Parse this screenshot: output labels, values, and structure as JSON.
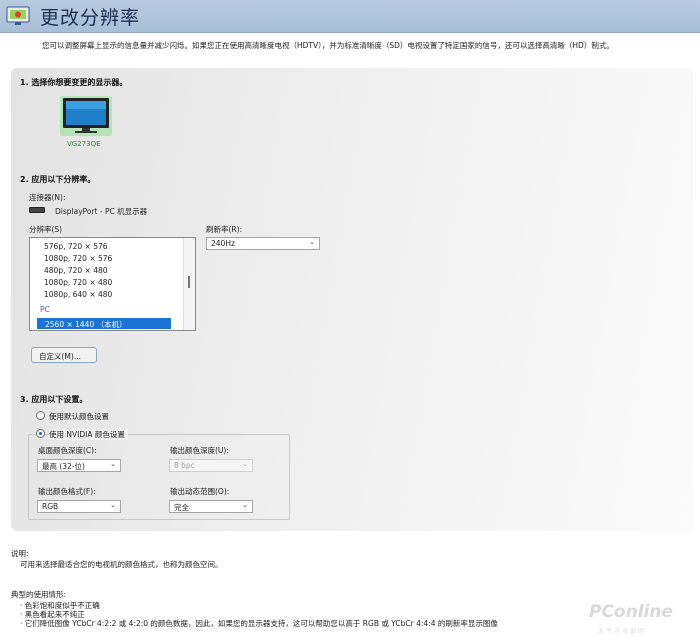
{
  "header": {
    "title": "更改分辨率",
    "icon": "display-settings-icon"
  },
  "intro": "您可以调整屏幕上显示的信息量并减少闪烁。如果您正在使用高清晰度电视（HDTV），并为标准清晰度（SD）电视设置了特定国家的信号，还可以选择高清晰（HD）制式。",
  "section1": {
    "title": "1. 选择你想要变更的显示器。",
    "monitor_name": "VG273QE"
  },
  "section2": {
    "title": "2. 应用以下分辨率。",
    "connector_label": "连接器(N):",
    "connector_value": "DisplayPort - PC 机显示器",
    "resolution_label": "分辨率(S)",
    "resolutions": [
      "576p, 720 × 576",
      "1080p, 720 × 576",
      "480p, 720 × 480",
      "1080p, 720 × 480",
      "1080p, 640 × 480"
    ],
    "group_pc": "PC",
    "selected_resolution": "2560 × 1440 （本机）",
    "refresh_label": "刷新率(R):",
    "refresh_value": "240Hz",
    "custom_button": "自定义(M)..."
  },
  "section3": {
    "title": "3. 应用以下设置。",
    "radio_default": "使用默认颜色设置",
    "radio_nvidia": "使用 NVIDIA 颜色设置",
    "desktop_depth_label": "桌面颜色深度(C):",
    "desktop_depth_value": "最高 (32-位)",
    "output_depth_label": "输出颜色深度(U):",
    "output_depth_value": "8 bpc",
    "output_format_label": "输出颜色格式(F):",
    "output_format_value": "RGB",
    "output_range_label": "输出动态范围(O):",
    "output_range_value": "完全"
  },
  "description": {
    "title": "说明:",
    "text": "可用来选择最适合您的电视机的颜色格式，也称为颜色空间。"
  },
  "usage": {
    "title": "典型的使用情形:",
    "items": [
      "色彩饱和度似乎不正确",
      "黑色看起来不纯正",
      "它们降低图像 YCbCr 4:2:2 或 4:2:0 的颜色数据，因此，如果您的显示器支持，这可以帮助您以高于 RGB 或 YCbCr 4:4:4 的刷新率显示图像"
    ]
  },
  "watermark": {
    "text": "PConline",
    "sub": "太平洋电脑网"
  },
  "colors": {
    "header_bg": "#b8cbe0",
    "selection": "#1b73d6",
    "monitor_label": "#2a8a2a"
  }
}
